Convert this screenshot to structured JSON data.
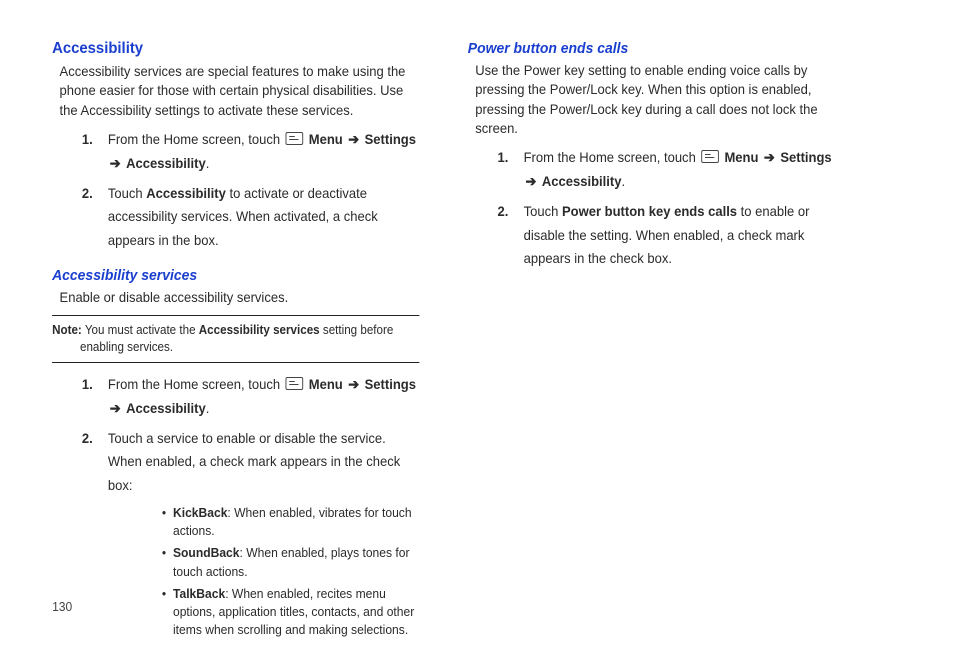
{
  "pageNumber": "130",
  "left": {
    "h1": "Accessibility",
    "intro": "Accessibility services are special features to make using the phone easier for those with certain physical disabilities. Use the Accessibility settings to activate these services.",
    "step1_a": "From the Home screen, touch",
    "step1_menu": "Menu",
    "step1_settings": "Settings",
    "step1_access": "Accessibility",
    "step2_a": "Touch",
    "step2_b": "Accessibility",
    "step2_c": "to activate or deactivate accessibility services. When activated, a check appears in the box.",
    "h2": "Accessibility services",
    "servicesIntro": "Enable or disable accessibility services.",
    "note_label": "Note:",
    "note_a": "You must activate the",
    "note_bold": "Accessibility services",
    "note_b": "setting before enabling services.",
    "svc_step1_a": "From the Home screen, touch",
    "svc_step1_menu": "Menu",
    "svc_step1_settings": "Settings",
    "svc_step1_access": "Accessibility",
    "svc_step2": "Touch a service to enable or disable the service. When enabled, a check mark appears in the check box:",
    "bullets": {
      "kick_name": "KickBack",
      "kick_desc": ": When enabled, vibrates for touch actions.",
      "sound_name": "SoundBack",
      "sound_desc": ": When enabled, plays tones for touch actions.",
      "talk_name": "TalkBack",
      "talk_desc": ": When enabled, recites menu options, application titles, contacts, and other items when scrolling and making selections."
    }
  },
  "right": {
    "h2": "Power button ends calls",
    "intro": "Use the Power key setting to enable ending voice calls by pressing the Power/Lock key. When this option is enabled, pressing the Power/Lock key during a call does not lock the screen.",
    "step1_a": "From the Home screen, touch",
    "step1_menu": "Menu",
    "step1_settings": "Settings",
    "step1_access": "Accessibility",
    "step2_a": "Touch",
    "step2_b": "Power button key ends calls",
    "step2_c": "to enable or disable the setting. When enabled, a check mark appears in the check box."
  },
  "arrow": "➔"
}
